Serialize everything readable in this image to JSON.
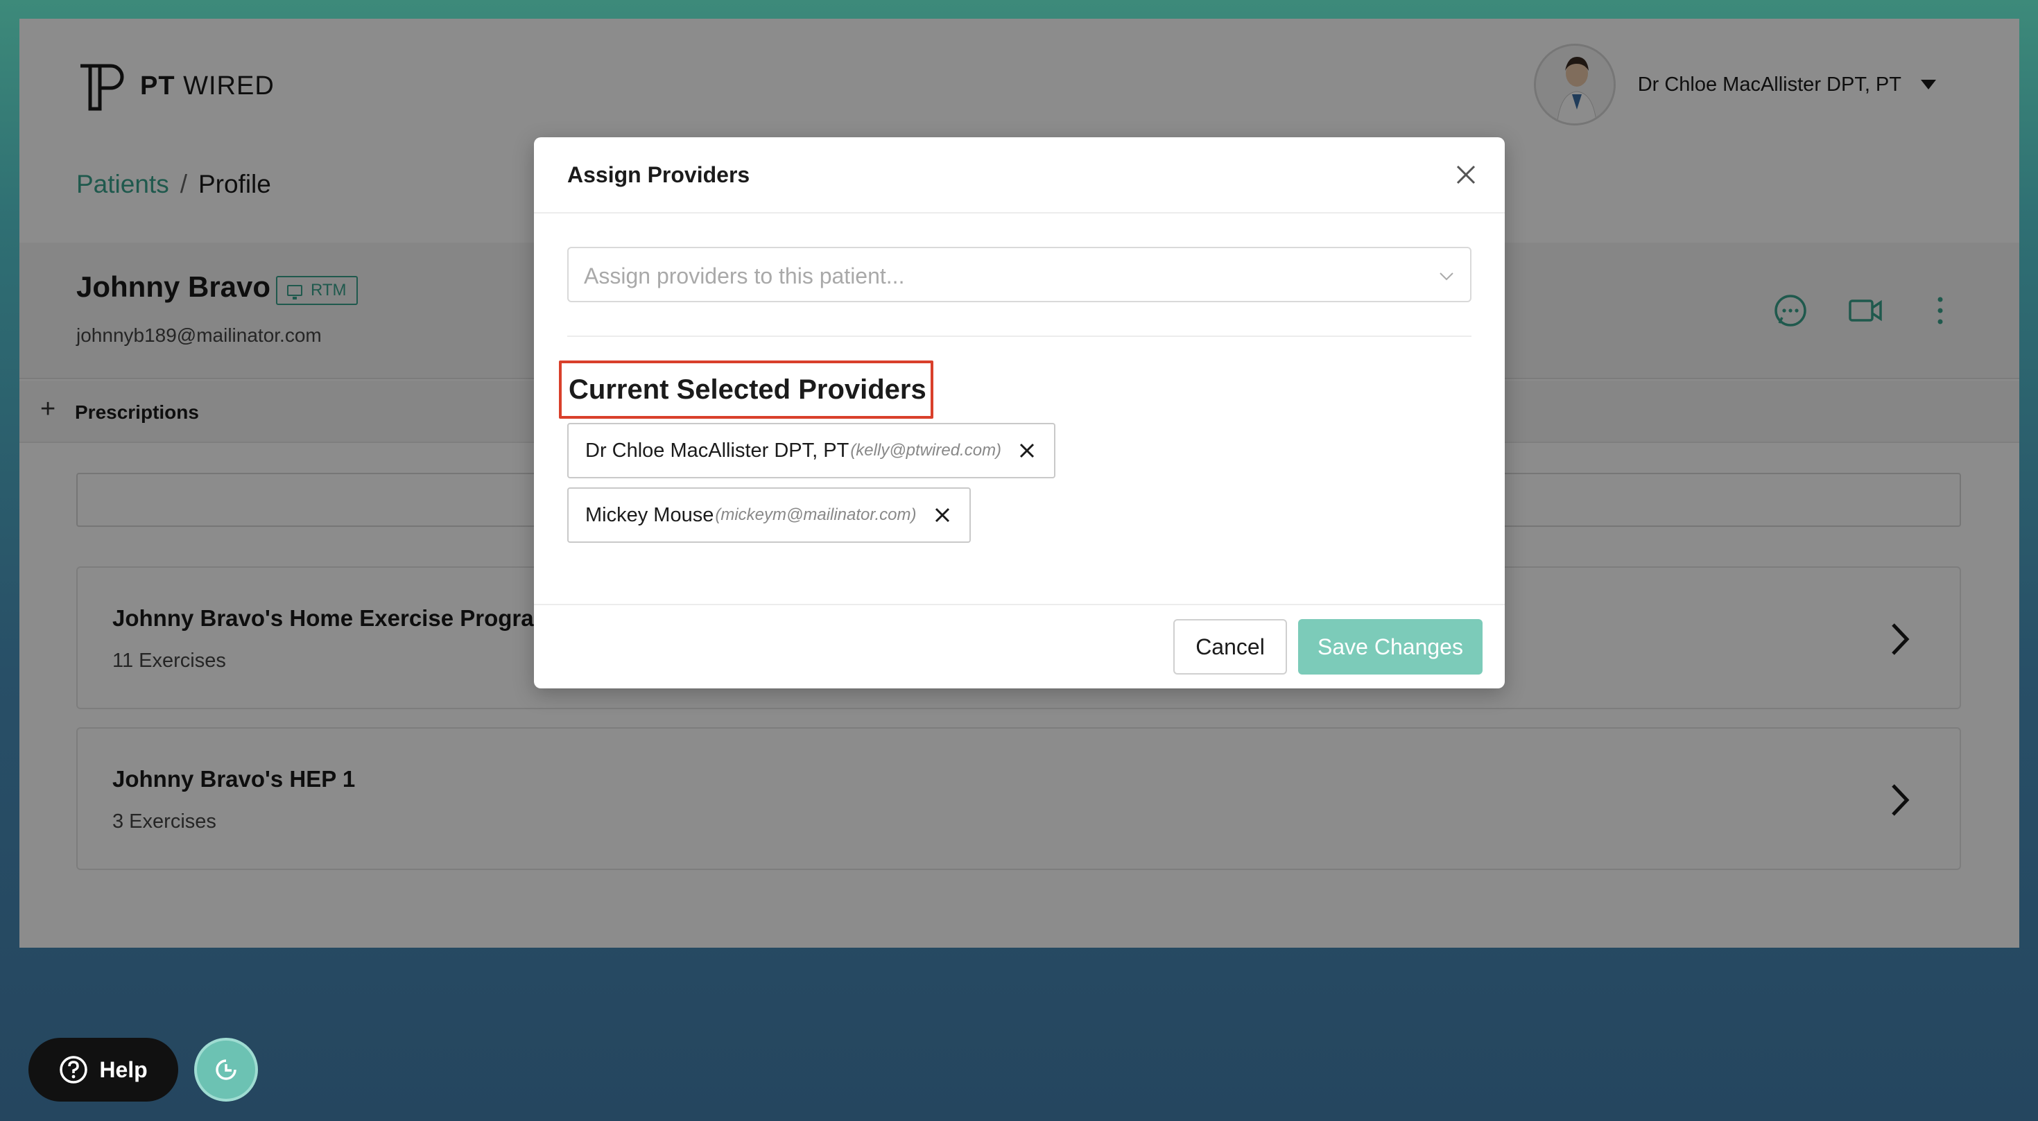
{
  "brand": {
    "logo_bold": "PT",
    "logo_light": "WIRED"
  },
  "user": {
    "name": "Dr Chloe MacAllister DPT, PT"
  },
  "breadcrumb": {
    "link": "Patients",
    "separator": "/",
    "current": "Profile"
  },
  "patient": {
    "name": "Johnny Bravo",
    "badge": "RTM",
    "email": "johnnyb189@mailinator.com"
  },
  "prescriptions": {
    "toggle": "+",
    "label": "Prescriptions"
  },
  "programs": [
    {
      "title": "Johnny Bravo's Home Exercise Program",
      "subtitle": "11 Exercises"
    },
    {
      "title": "Johnny Bravo's HEP 1",
      "subtitle": "3 Exercises"
    }
  ],
  "modal": {
    "title": "Assign Providers",
    "select_placeholder": "Assign providers to this patient...",
    "section_title": "Current Selected Providers",
    "providers": [
      {
        "name": "Dr Chloe MacAllister DPT, PT",
        "email": "(kelly@ptwired.com)"
      },
      {
        "name": "Mickey Mouse",
        "email": "(mickeym@mailinator.com)"
      }
    ],
    "cancel_label": "Cancel",
    "save_label": "Save Changes"
  },
  "help": {
    "label": "Help"
  },
  "colors": {
    "accent": "#3aa38c",
    "save_button": "#7ccbb9",
    "highlight_border": "#d9402b"
  },
  "icons": [
    "logo-icon",
    "chevron-down-icon",
    "chat-icon",
    "video-icon",
    "more-vertical-icon",
    "chevron-right-icon",
    "close-icon",
    "help-icon",
    "clock-icon"
  ]
}
